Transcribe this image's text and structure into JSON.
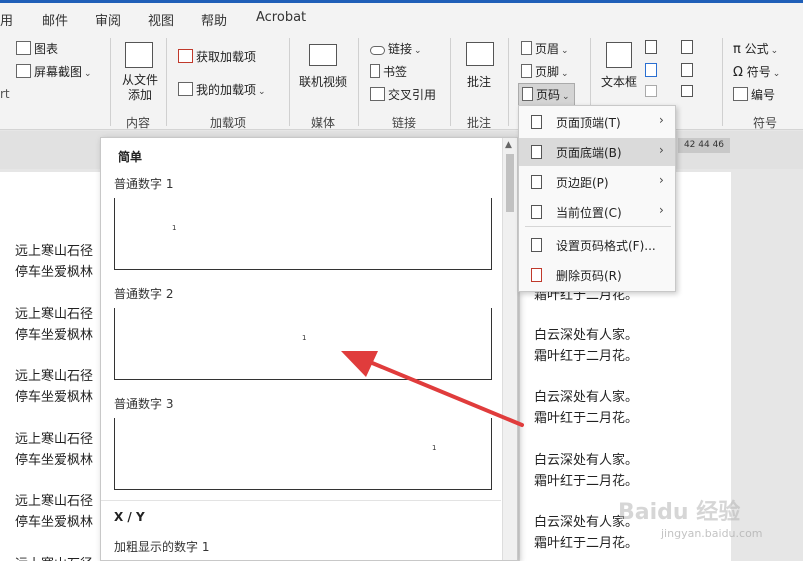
{
  "tabs": [
    "用",
    "邮件",
    "审阅",
    "视图",
    "帮助",
    "Acrobat"
  ],
  "ribbon": {
    "chart_label": "图表",
    "screenshot_label": "屏幕截图",
    "rt_label": "rt",
    "from_file_label": "从文件添加",
    "content_group": "内容",
    "get_addins_label": "获取加载项",
    "my_addins_label": "我的加载项",
    "addins_group": "加载项",
    "online_video_label": "联机视频",
    "media_group": "媒体",
    "link_label": "链接",
    "bookmark_label": "书签",
    "cross_ref_label": "交叉引用",
    "links_group": "链接",
    "comment_label": "批注",
    "comments_group": "批注",
    "header_label": "页眉",
    "footer_label": "页脚",
    "page_number_label": "页码",
    "textbox_label": "文本框",
    "formula_label": "公式",
    "symbol_label": "符号",
    "number_label": "编号",
    "symbols_group": "符号"
  },
  "ruler_numbers": "42 44 46",
  "gallery": {
    "section_simple": "简单",
    "item1": "普通数字 1",
    "item2": "普通数字 2",
    "item3": "普通数字 3",
    "section_xy": "X / Y",
    "item4": "加粗显示的数字 1",
    "page_num": "1"
  },
  "menu": {
    "items": [
      {
        "label": "页面顶端(T)",
        "has_submenu": true
      },
      {
        "label": "页面底端(B)",
        "has_submenu": true
      },
      {
        "label": "页边距(P)",
        "has_submenu": true
      },
      {
        "label": "当前位置(C)",
        "has_submenu": true
      },
      {
        "label": "设置页码格式(F)...",
        "has_submenu": false
      },
      {
        "label": "删除页码(R)",
        "has_submenu": false
      }
    ],
    "selected_index": 1
  },
  "document": {
    "left_lines": [
      "远上寒山石径",
      "停车坐爱枫林"
    ],
    "right_partial": "霜叶红于二月花。",
    "right_line1": "白云深处有人家。",
    "right_line2": "霜叶红于二月花。"
  },
  "watermark": {
    "brand": "Baidu 经验",
    "url": "jingyan.baidu.com"
  },
  "colors": {
    "accent": "#1f5fb8",
    "arrow": "#e03c3c",
    "menu_selected": "#dadada"
  }
}
